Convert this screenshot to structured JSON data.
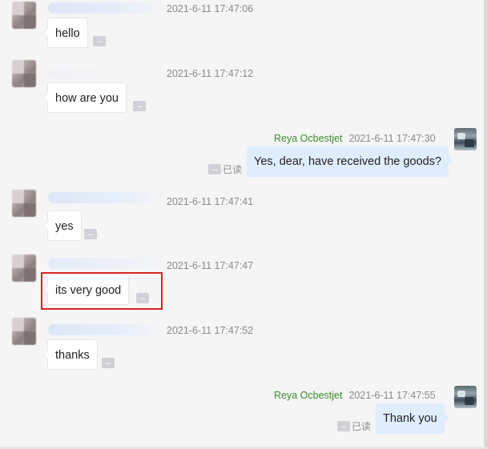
{
  "conversation": {
    "messages": [
      {
        "direction": "incoming",
        "sender": "",
        "timestamp": "2021-6-11 17:47:06",
        "text": "hello",
        "more": "..."
      },
      {
        "direction": "incoming",
        "sender": "",
        "timestamp": "2021-6-11 17:47:12",
        "text": "how are you",
        "more": "..."
      },
      {
        "direction": "outgoing",
        "sender": "Reya Ocbestjet",
        "timestamp": "2021-6-11 17:47:30",
        "text": "Yes, dear, have received the goods?",
        "status": "已读",
        "more": "..."
      },
      {
        "direction": "incoming",
        "sender": "",
        "timestamp": "2021-6-11 17:47:41",
        "text": "yes",
        "more": "..."
      },
      {
        "direction": "incoming",
        "sender": "",
        "timestamp": "2021-6-11 17:47:47",
        "text": "its very good",
        "more": "...",
        "highlighted": true
      },
      {
        "direction": "incoming",
        "sender": "",
        "timestamp": "2021-6-11 17:47:52",
        "text": "thanks",
        "more": "..."
      },
      {
        "direction": "outgoing",
        "sender": "Reya Ocbestjet",
        "timestamp": "2021-6-11 17:47:55",
        "text": "Thank you",
        "status": "已读",
        "more": "..."
      }
    ]
  },
  "colors": {
    "sender_name": "#3a8b2c",
    "outgoing_bubble": "#e0edff",
    "incoming_bubble": "#ffffff",
    "highlight_border": "#d62424",
    "timestamp": "#8a8a8a"
  },
  "icons": {
    "more": "more-options-icon",
    "read": "read-receipt-icon"
  }
}
